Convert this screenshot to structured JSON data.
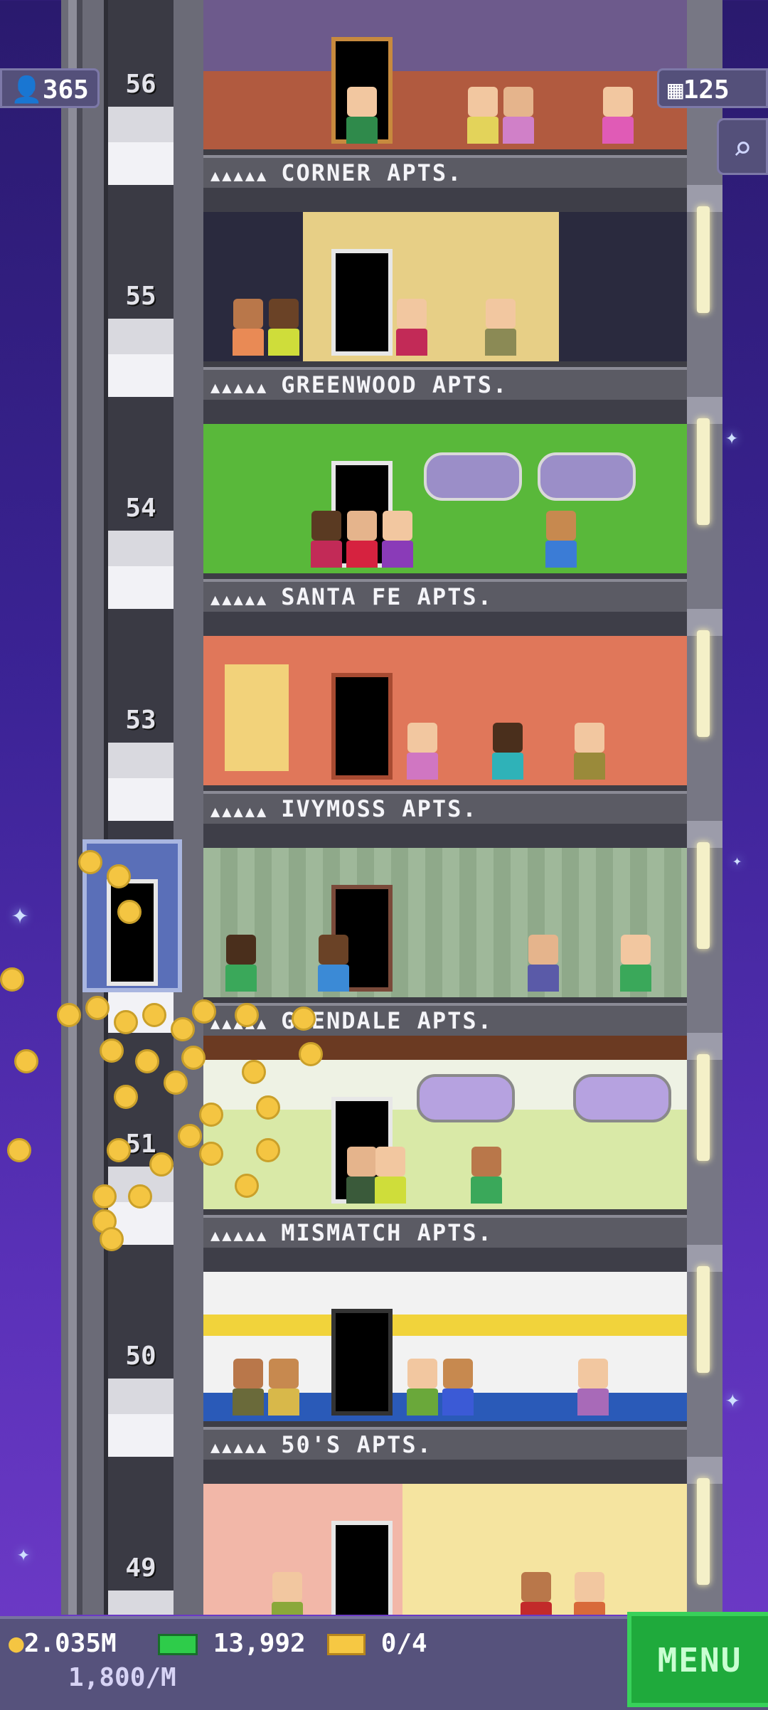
{
  "hud": {
    "population": "365",
    "floors": "125",
    "coins": "2.035M",
    "bux": "13,992",
    "tickets": "0/4",
    "income": "1,800/M",
    "menu_label": "MENU"
  },
  "icons": {
    "population": "person-icon",
    "floors": "building-icon",
    "search": "magnifier-icon",
    "coins": "coin-icon",
    "bux": "banknote-icon",
    "tickets": "ticket-icon"
  },
  "shaft_numbers": [
    "56",
    "55",
    "54",
    "53",
    "51",
    "50",
    "49"
  ],
  "floors": [
    {
      "name": "CORNER APTS.",
      "stars": "▲▲▲▲▲",
      "wall": "#6d5a8c",
      "accent": "#b15a3f"
    },
    {
      "name": "GREENWOOD APTS.",
      "stars": "▲▲▲▲▲",
      "wall": "#e7cf86",
      "accent": "#3a3a4a"
    },
    {
      "name": "SANTA FE APTS.",
      "stars": "▲▲▲▲▲",
      "wall": "#59b83a",
      "accent": "#4aa12c"
    },
    {
      "name": "IVYMOSS APTS.",
      "stars": "▲▲▲▲▲",
      "wall": "#e0775a",
      "accent": "#f2d27a"
    },
    {
      "name": "GLENDALE APTS.",
      "stars": "▲▲▲▲▲",
      "wall": "#9fb89a",
      "accent": "#7a4a3a"
    },
    {
      "name": "MISMATCH APTS.",
      "stars": "▲▲▲▲▲",
      "wall": "#d9e9a7",
      "accent": "#b6a2e0"
    },
    {
      "name": "50'S APTS.",
      "stars": "▲▲▲▲▲",
      "wall": "#f2f2f2",
      "accent": "#f1d33b"
    }
  ],
  "colors": {
    "coin": "#f4c542",
    "menu_green": "#1faa3c",
    "hud_bg": "#56527c"
  }
}
